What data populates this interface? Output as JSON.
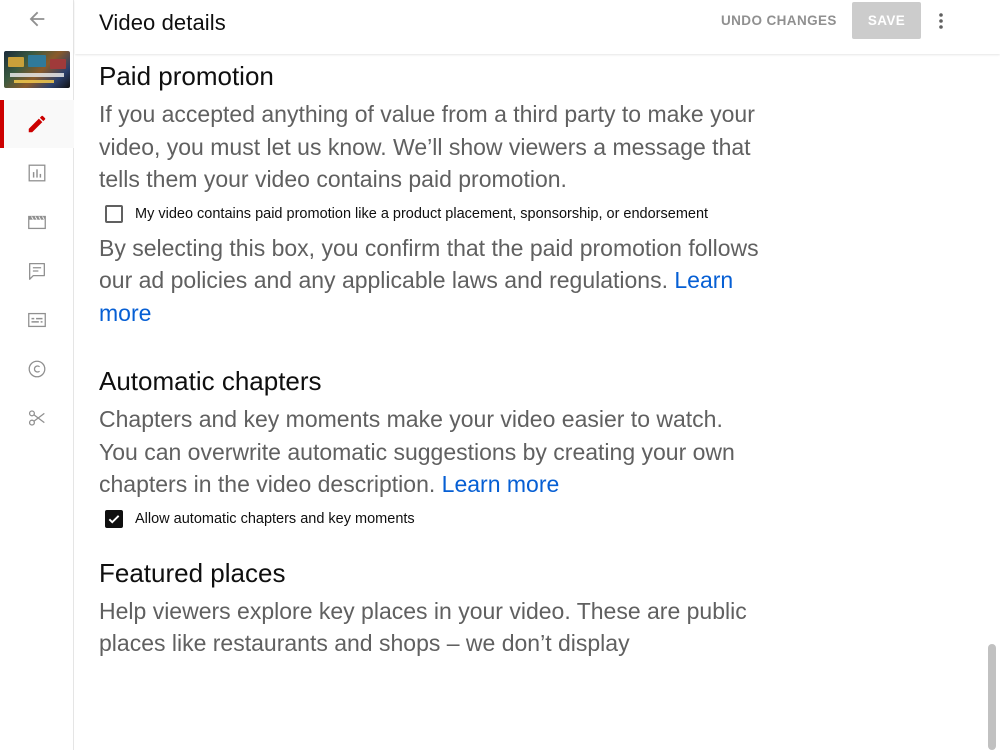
{
  "header": {
    "title": "Video details",
    "undo_label": "UNDO CHANGES",
    "save_label": "SAVE"
  },
  "rail": {
    "items": [
      {
        "name": "details",
        "icon": "pencil-icon",
        "active": true
      },
      {
        "name": "analytics",
        "icon": "bar-chart-icon"
      },
      {
        "name": "editor",
        "icon": "clapperboard-icon"
      },
      {
        "name": "comments",
        "icon": "comment-icon"
      },
      {
        "name": "subtitles",
        "icon": "subtitles-icon"
      },
      {
        "name": "copyright",
        "icon": "copyright-icon"
      },
      {
        "name": "clips",
        "icon": "scissors-icon"
      }
    ]
  },
  "sections": {
    "paid": {
      "title": "Paid promotion",
      "text": "If you accepted anything of value from a third party to make your video, you must let us know. We’ll show viewers a message that tells them your video contains paid promotion.",
      "checkbox_label": "My video contains paid promotion like a product placement, sponsorship, or endorsement",
      "checked": false,
      "note": "By selecting this box, you confirm that the paid promotion follows our ad policies and any applicable laws and regulations.",
      "link": "Learn more"
    },
    "chapters": {
      "title": "Automatic chapters",
      "text": "Chapters and key moments make your video easier to watch. You can overwrite automatic suggestions by creating your own chapters in the video description.",
      "link": "Learn more",
      "checkbox_label": "Allow automatic chapters and key moments",
      "checked": true
    },
    "places": {
      "title": "Featured places",
      "text": "Help viewers explore key places in your video. These are public places like restaurants and shops – we don’t display"
    }
  },
  "colors": {
    "accent_red": "#cc0000",
    "link_blue": "#065fd4",
    "muted_text": "#606060",
    "disabled_button": "#cccccc"
  }
}
